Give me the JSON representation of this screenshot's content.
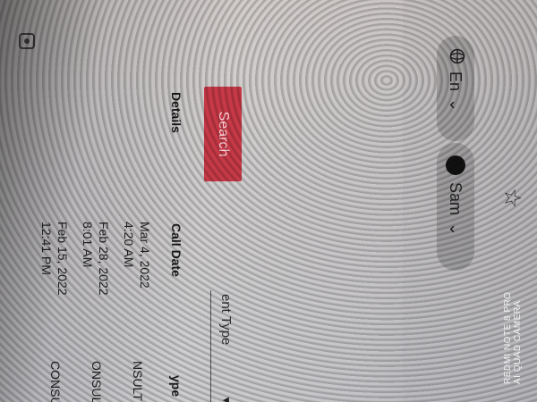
{
  "header": {
    "language_label": "En",
    "user_label": "Sam"
  },
  "search": {
    "button_label": "Search",
    "type_select_value": "ent Type"
  },
  "table": {
    "columns": {
      "type": "ype",
      "call_date": "Call Date",
      "details": "Details"
    },
    "rows": [
      {
        "type": "NSULT",
        "date": "Mar 4, 2022",
        "time": "4:20 AM"
      },
      {
        "type": "ONSULT",
        "date": "Feb 28, 2022",
        "time": "8:01 AM"
      },
      {
        "type": "CONSULT",
        "date": "Feb 15, 2022",
        "time": "12:41 PM"
      }
    ]
  },
  "watermark": {
    "line1": "REDMI NOTE 8 PRO",
    "line2": "AI QUAD CAMERA"
  }
}
